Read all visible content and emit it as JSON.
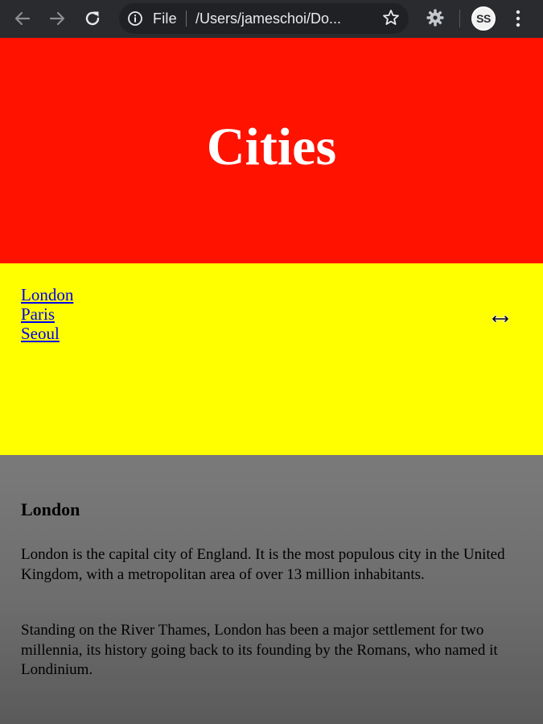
{
  "browser": {
    "scheme_label": "File",
    "url": "/Users/jameschoi/Do...",
    "profile_initials": "SS",
    "colors": {
      "toolbar": "#2a2b2e",
      "omnibox": "#202124",
      "icon": "#c4c7cb"
    },
    "icons": [
      "back-arrow-icon",
      "forward-arrow-icon",
      "reload-icon",
      "info-icon",
      "star-icon",
      "extension-gear-icon",
      "menu-dots-icon"
    ]
  },
  "page": {
    "header": {
      "title": "Cities",
      "background": "#ff1200"
    },
    "nav": {
      "background": "#ffff00",
      "links": [
        "London",
        "Paris",
        "Seoul"
      ]
    },
    "article": {
      "title": "London",
      "paragraphs": [
        "London is the capital city of England. It is the most populous city in the United Kingdom, with a metropolitan area of over 13 million inhabitants.",
        "Standing on the River Thames, London has been a major settlement for two millennia, its history going back to its founding by the Romans, who named it Londinium."
      ],
      "background": "#737373"
    }
  }
}
